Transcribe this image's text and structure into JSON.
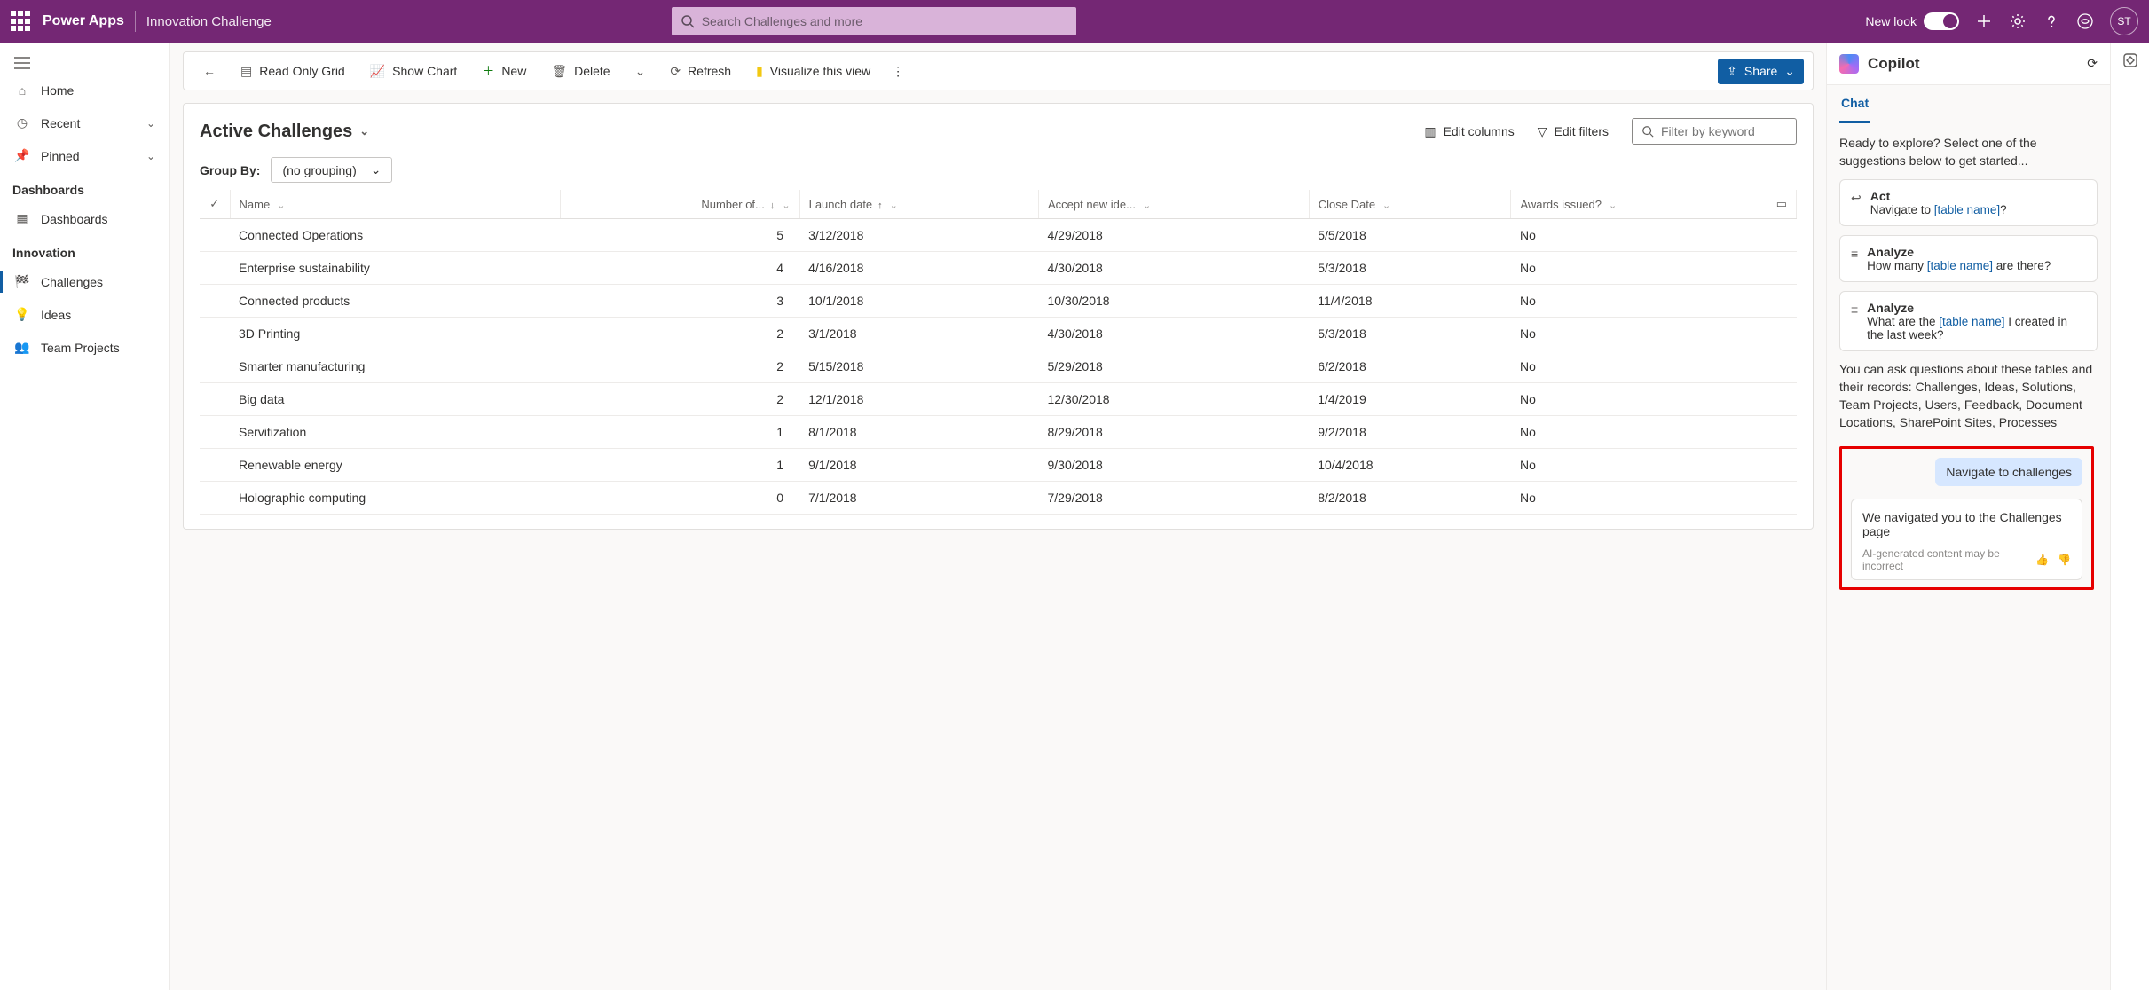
{
  "header": {
    "app": "Power Apps",
    "env": "Innovation Challenge",
    "search_placeholder": "Search Challenges and more",
    "new_look": "New look",
    "avatar": "ST"
  },
  "nav": {
    "home": "Home",
    "recent": "Recent",
    "pinned": "Pinned",
    "section_dashboards": "Dashboards",
    "dashboards": "Dashboards",
    "section_innovation": "Innovation",
    "challenges": "Challenges",
    "ideas": "Ideas",
    "team_projects": "Team Projects"
  },
  "cmd": {
    "read_only": "Read Only Grid",
    "show_chart": "Show Chart",
    "new": "New",
    "delete": "Delete",
    "refresh": "Refresh",
    "visualize": "Visualize this view",
    "share": "Share"
  },
  "view": {
    "title": "Active Challenges",
    "edit_columns": "Edit columns",
    "edit_filters": "Edit filters",
    "filter_placeholder": "Filter by keyword",
    "group_by_label": "Group By:",
    "group_by_value": "(no grouping)"
  },
  "columns": {
    "name": "Name",
    "number": "Number of...",
    "launch": "Launch date",
    "accept": "Accept new ide...",
    "close": "Close Date",
    "awards": "Awards issued?"
  },
  "rows": [
    {
      "name": "Connected Operations",
      "num": "5",
      "launch": "3/12/2018",
      "accept": "4/29/2018",
      "close": "5/5/2018",
      "awards": "No"
    },
    {
      "name": "Enterprise sustainability",
      "num": "4",
      "launch": "4/16/2018",
      "accept": "4/30/2018",
      "close": "5/3/2018",
      "awards": "No"
    },
    {
      "name": "Connected products",
      "num": "3",
      "launch": "10/1/2018",
      "accept": "10/30/2018",
      "close": "11/4/2018",
      "awards": "No"
    },
    {
      "name": "3D Printing",
      "num": "2",
      "launch": "3/1/2018",
      "accept": "4/30/2018",
      "close": "5/3/2018",
      "awards": "No"
    },
    {
      "name": "Smarter manufacturing",
      "num": "2",
      "launch": "5/15/2018",
      "accept": "5/29/2018",
      "close": "6/2/2018",
      "awards": "No"
    },
    {
      "name": "Big data",
      "num": "2",
      "launch": "12/1/2018",
      "accept": "12/30/2018",
      "close": "1/4/2019",
      "awards": "No"
    },
    {
      "name": "Servitization",
      "num": "1",
      "launch": "8/1/2018",
      "accept": "8/29/2018",
      "close": "9/2/2018",
      "awards": "No"
    },
    {
      "name": "Renewable energy",
      "num": "1",
      "launch": "9/1/2018",
      "accept": "9/30/2018",
      "close": "10/4/2018",
      "awards": "No"
    },
    {
      "name": "Holographic computing",
      "num": "0",
      "launch": "7/1/2018",
      "accept": "7/29/2018",
      "close": "8/2/2018",
      "awards": "No"
    }
  ],
  "copilot": {
    "title": "Copilot",
    "tab_chat": "Chat",
    "intro": "Ready to explore? Select one of the suggestions below to get started...",
    "sugg1_title": "Act",
    "sugg1_pre": "Navigate to ",
    "sugg1_link": "[table name]",
    "sugg1_post": "?",
    "sugg2_title": "Analyze",
    "sugg2_pre": "How many ",
    "sugg2_link": "[table name]",
    "sugg2_post": " are there?",
    "sugg3_title": "Analyze",
    "sugg3_pre": "What are the ",
    "sugg3_link": "[table name]",
    "sugg3_post": " I created in the last week?",
    "tables_text": "You can ask questions about these tables and their records: Challenges, Ideas, Solutions, Team Projects, Users, Feedback, Document Locations, SharePoint Sites, Processes",
    "user_msg": "Navigate to challenges",
    "bot_msg": "We navigated you to the Challenges page",
    "disclaimer": "AI-generated content may be incorrect"
  }
}
